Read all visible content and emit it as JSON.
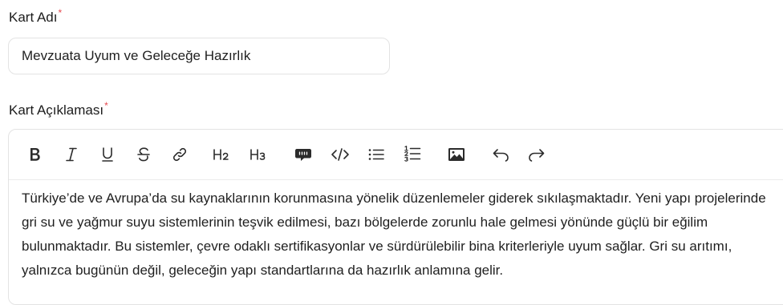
{
  "form": {
    "card_name_label": "Kart Adı",
    "card_name_required": "*",
    "card_name_value": "Mevzuata Uyum ve Geleceğe Hazırlık",
    "card_desc_label": "Kart Açıklaması",
    "card_desc_required": "*"
  },
  "toolbar": {
    "bold": "B",
    "italic": "I",
    "underline": "U",
    "strike": "S",
    "heading2": "H2",
    "heading3": "H3",
    "icons": [
      "bold-icon",
      "italic-icon",
      "underline-icon",
      "strikethrough-icon",
      "link-icon",
      "heading2-icon",
      "heading3-icon",
      "comment-icon",
      "code-icon",
      "bullet-list-icon",
      "ordered-list-icon",
      "image-icon",
      "undo-icon",
      "redo-icon"
    ]
  },
  "editor": {
    "content": "Türkiye’de ve Avrupa’da su kaynaklarının korunmasına yönelik düzenlemeler giderek sıkılaşmaktadır. Yeni yapı projelerinde gri su ve yağmur suyu sistemlerinin teşvik edilmesi, bazı bölgelerde zorunlu hale gelmesi yönünde güçlü bir eğilim bulunmaktadır. Bu sistemler, çevre odaklı sertifikasyonlar ve sürdürülebilir bina kriterleriyle uyum sağlar. Gri su arıtımı, yalnızca bugünün değil, geleceğin yapı standartlarına da hazırlık anlamına gelir."
  }
}
